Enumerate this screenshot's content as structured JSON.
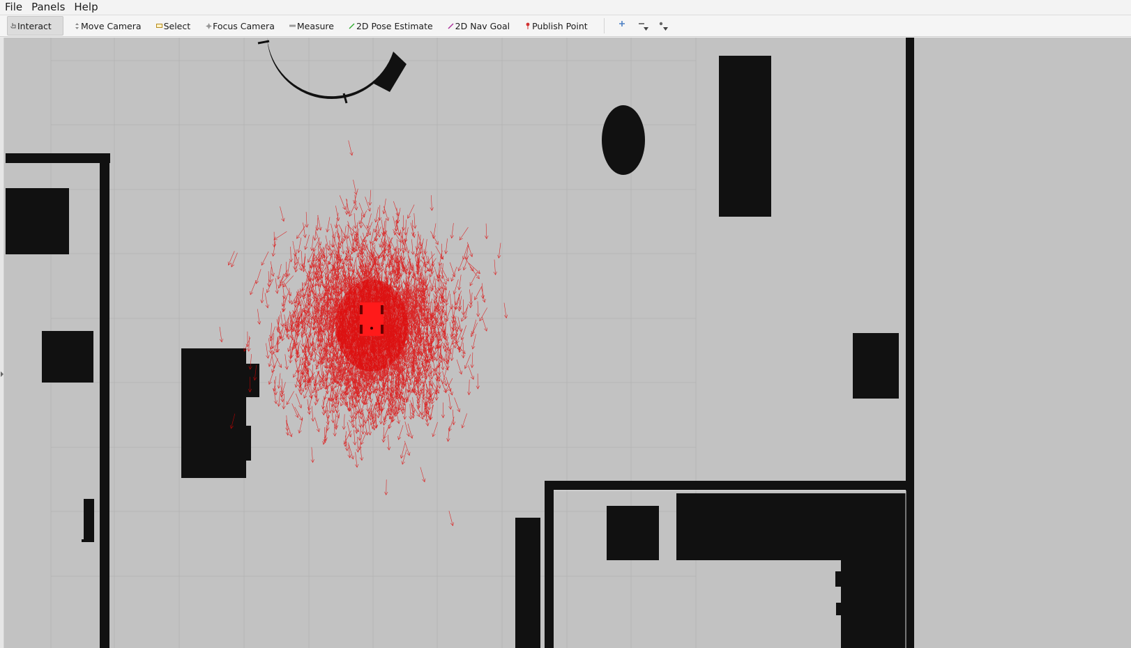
{
  "menubar": {
    "items": [
      {
        "label": "File"
      },
      {
        "label": "Panels"
      },
      {
        "label": "Help"
      }
    ]
  },
  "toolbar": {
    "tools": [
      {
        "label": "Interact",
        "icon": "hand-pointer-icon",
        "active": true
      },
      {
        "label": "Move Camera",
        "icon": "move-camera-icon",
        "active": false
      },
      {
        "label": "Select",
        "icon": "select-rect-icon",
        "active": false
      },
      {
        "label": "Focus Camera",
        "icon": "focus-camera-icon",
        "active": false
      },
      {
        "label": "Measure",
        "icon": "measure-icon",
        "active": false
      },
      {
        "label": "2D Pose Estimate",
        "icon": "pose-estimate-arrow-icon",
        "active": false
      },
      {
        "label": "2D Nav Goal",
        "icon": "nav-goal-arrow-icon",
        "active": false
      },
      {
        "label": "Publish Point",
        "icon": "publish-point-pin-icon",
        "active": false
      }
    ],
    "extra_buttons": [
      {
        "icon": "add-tool-plus-icon"
      },
      {
        "icon": "remove-tool-minus-icon"
      },
      {
        "icon": "tool-properties-icon"
      }
    ]
  },
  "colors": {
    "map_free": "#c2c2c2",
    "obstacle": "#111111",
    "particles": "#e00000",
    "robot": "#ff1a1a",
    "grid": "#b5b5b5"
  },
  "display": {
    "particle_cloud": {
      "particle_count": 3000
    }
  }
}
